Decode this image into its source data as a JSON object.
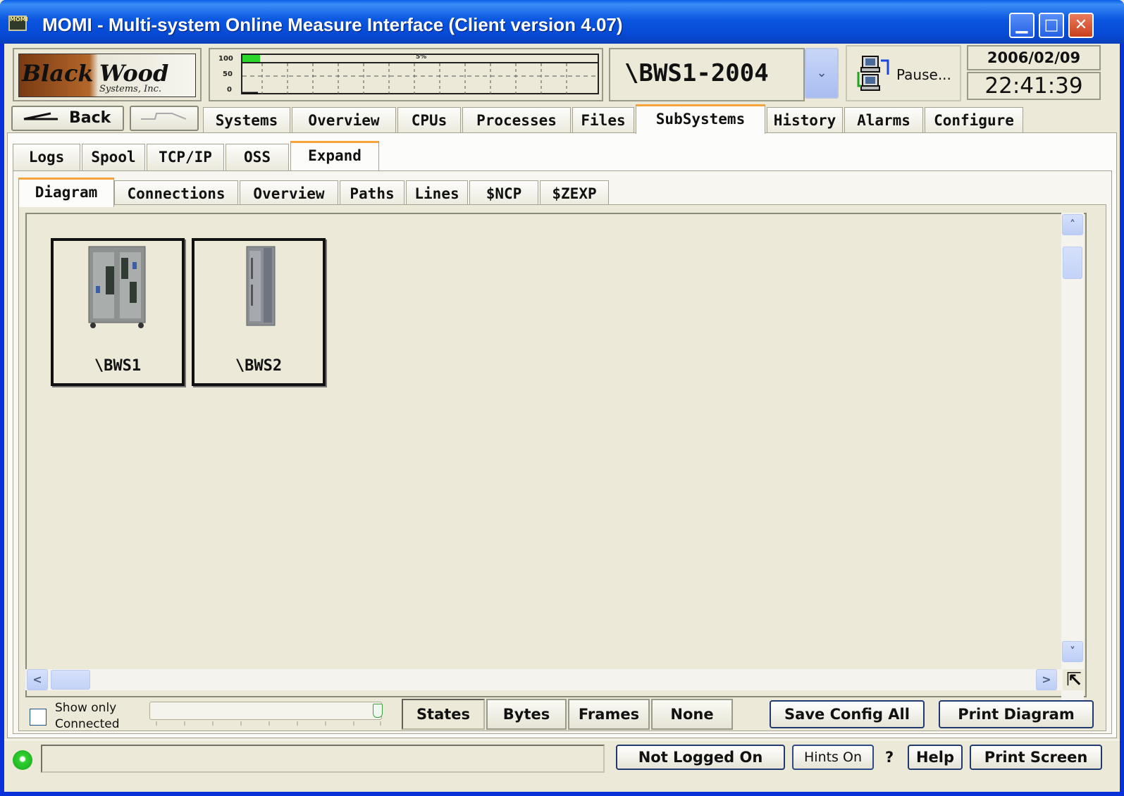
{
  "window": {
    "title": "MOMI - Multi-system Online Measure Interface (Client version 4.07)",
    "icon_name": "momi-app-icon",
    "icon_text": "MOMI",
    "controls": [
      "minimize",
      "maximize",
      "close"
    ]
  },
  "header": {
    "logo": {
      "line1": "Black",
      "line2": "Wood",
      "line3": "Systems, Inc."
    },
    "gauge": {
      "axis": [
        "100",
        "50",
        "0"
      ],
      "percent_label": "5%",
      "level": 0.05
    },
    "system": {
      "selected": "\\BWS1-2004"
    },
    "pause_label": "Pause...",
    "date": "2006/02/09",
    "time": "22:41:39"
  },
  "nav": {
    "back_label": "Back",
    "forward_label": "",
    "tabs": [
      {
        "label": "Systems"
      },
      {
        "label": "Overview"
      },
      {
        "label": "CPUs"
      },
      {
        "label": "Processes"
      },
      {
        "label": "Files"
      },
      {
        "label": "SubSystems",
        "active": true
      },
      {
        "label": "History"
      },
      {
        "label": "Alarms"
      },
      {
        "label": "Configure"
      }
    ]
  },
  "subtabs": [
    {
      "label": "Logs"
    },
    {
      "label": "Spool"
    },
    {
      "label": "TCP/IP"
    },
    {
      "label": "OSS"
    },
    {
      "label": "Expand",
      "active": true
    }
  ],
  "expand_tabs": [
    {
      "label": "Diagram",
      "active": true
    },
    {
      "label": "Connections"
    },
    {
      "label": "Overview"
    },
    {
      "label": "Paths"
    },
    {
      "label": "Lines"
    },
    {
      "label": "$NCP"
    },
    {
      "label": "$ZEXP"
    }
  ],
  "diagram": {
    "nodes": [
      {
        "label": "\\BWS1",
        "icon": "server-cabinet-double"
      },
      {
        "label": "\\BWS2",
        "icon": "server-cabinet-single"
      }
    ]
  },
  "controls": {
    "show_only_line1": "Show only",
    "show_only_line2": "Connected",
    "show_only_checked": false,
    "modes": [
      {
        "label": "States",
        "selected": true
      },
      {
        "label": "Bytes"
      },
      {
        "label": "Frames"
      },
      {
        "label": "None"
      }
    ],
    "save_label": "Save Config All",
    "print_diagram_label": "Print Diagram"
  },
  "statusbar": {
    "status_text": "",
    "login_label": "Not Logged On",
    "hints_label": "Hints On",
    "question": "?",
    "help_label": "Help",
    "print_screen_label": "Print Screen"
  },
  "colors": {
    "title_blue": "#0a56e0",
    "tab_active_accent": "#f6a33c",
    "status_led": "#2fd12f",
    "panel_bg": "#ece9d8"
  }
}
